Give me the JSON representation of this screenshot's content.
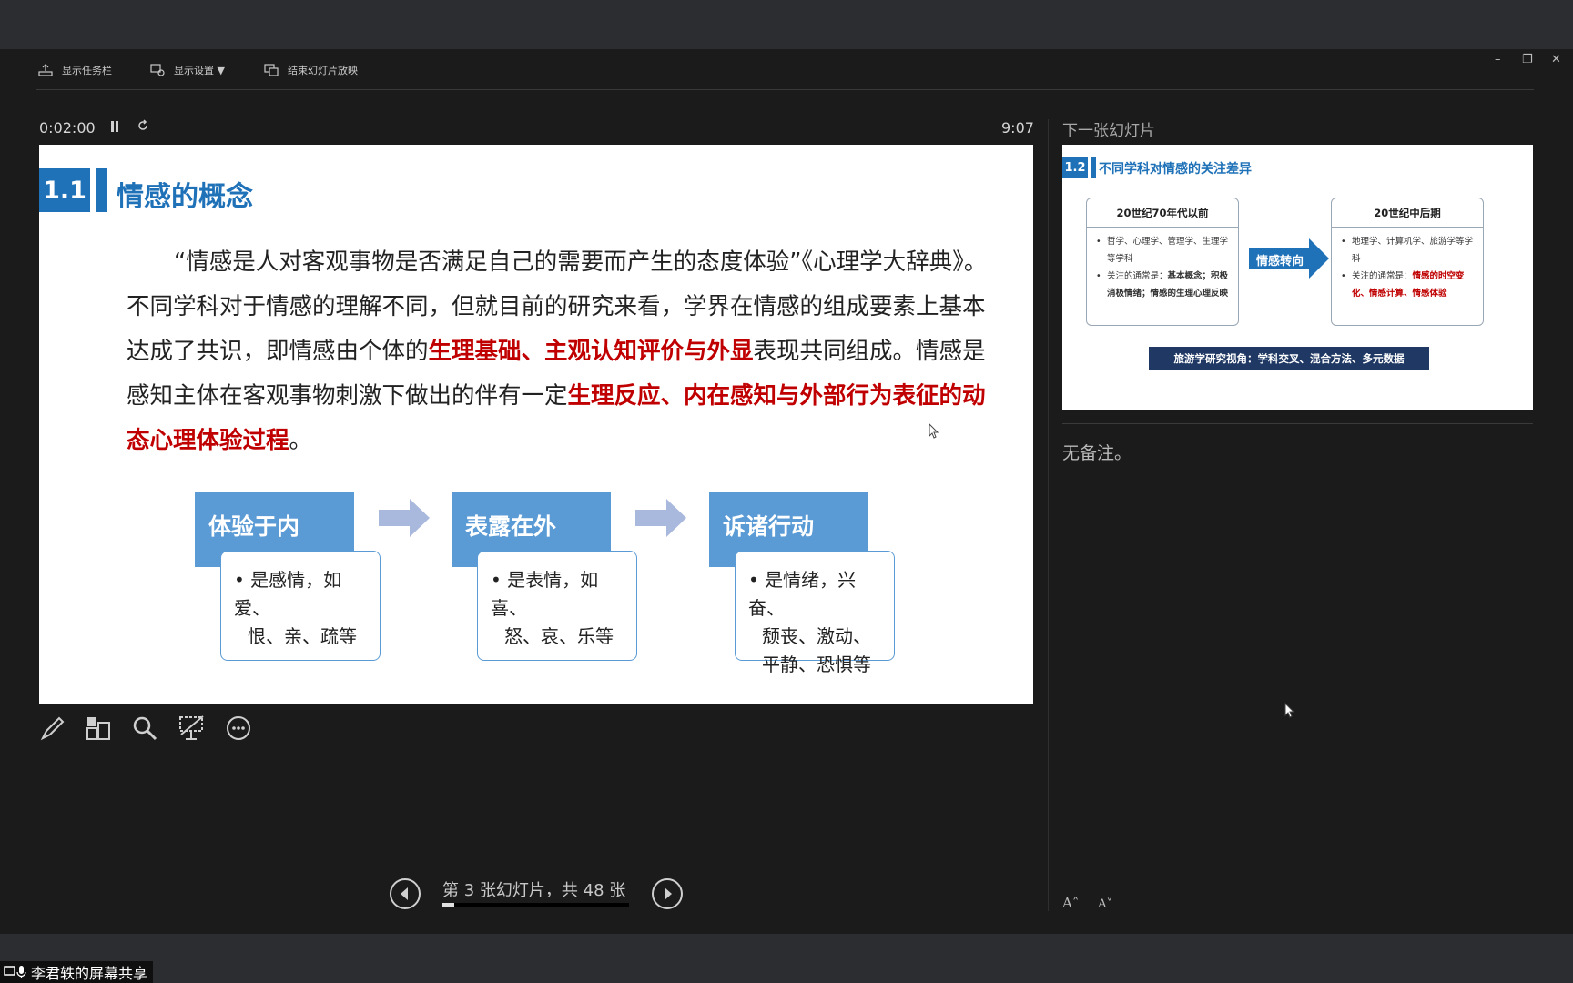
{
  "toolbar": {
    "show_taskbar": "显示任务栏",
    "display_settings": "显示设置 ▼",
    "end_slideshow": "结束幻灯片放映"
  },
  "presenter": {
    "elapsed": "0:02:00",
    "clock": "9:07",
    "next_slide_label": "下一张幻灯片",
    "notes": "无备注。",
    "counter": "第 3 张幻灯片，共 48 张",
    "progress_fraction": 0.0625
  },
  "slide": {
    "number": "1.1",
    "title": "情感的概念",
    "body": {
      "p1": "“情感是人对客观事物是否满足自己的需要而产生的态度体验”《心理学大辞典》。不同学科对于情感的理解不同，但就目前的研究来看，学界在情感的组成要素上基本达成了共识，即情感由个体的",
      "r1": "生理基础、主观认知评价与外显",
      "p2": "表现共同组成。情感是感知主体在客观事物刺激下做出的伴有一定",
      "r2": "生理反应、内在感知与外部行为表征的动态心理体验过程",
      "p3": "。"
    },
    "boxes": [
      {
        "head": "体验于内",
        "line1": "• 是感情，如爱、",
        "line2": "恨、亲、疏等"
      },
      {
        "head": "表露在外",
        "line1": "• 是表情，如喜、",
        "line2": "怒、哀、乐等"
      },
      {
        "head": "诉诸行动",
        "line1": "• 是情绪，兴奋、",
        "line2": "颓丧、激动、",
        "line3": "平静、恐惧等"
      }
    ]
  },
  "next_slide": {
    "number": "1.2",
    "title": "不同学科对情感的关注差异",
    "left_title": "20世纪70年代以前",
    "left_b1": "哲学、心理学、管理学、生理学等学科",
    "left_b2_prefix": "关注的通常是：",
    "left_b2_rest": "基本概念；积极消极情绪；情感的生理心理反映",
    "arrow_label": "情感转向",
    "right_title": "20世纪中后期",
    "right_b1": "地理学、计算机学、旅游学等学科",
    "right_b2_prefix": "关注的通常是：",
    "right_b2_red": "情感的时空变化、情感计算、情感体验",
    "footer": "旅游学研究视角：学科交叉、混合方法、多元数据"
  },
  "font_buttons": {
    "increase": "A˄",
    "decrease": "A˅"
  },
  "share": {
    "label": "李君轶的屏幕共享"
  },
  "colors": {
    "accent_blue": "#1f71b8",
    "box_blue": "#5b9bd5",
    "emphasis_red": "#c00000",
    "background": "#1b1b1b"
  }
}
